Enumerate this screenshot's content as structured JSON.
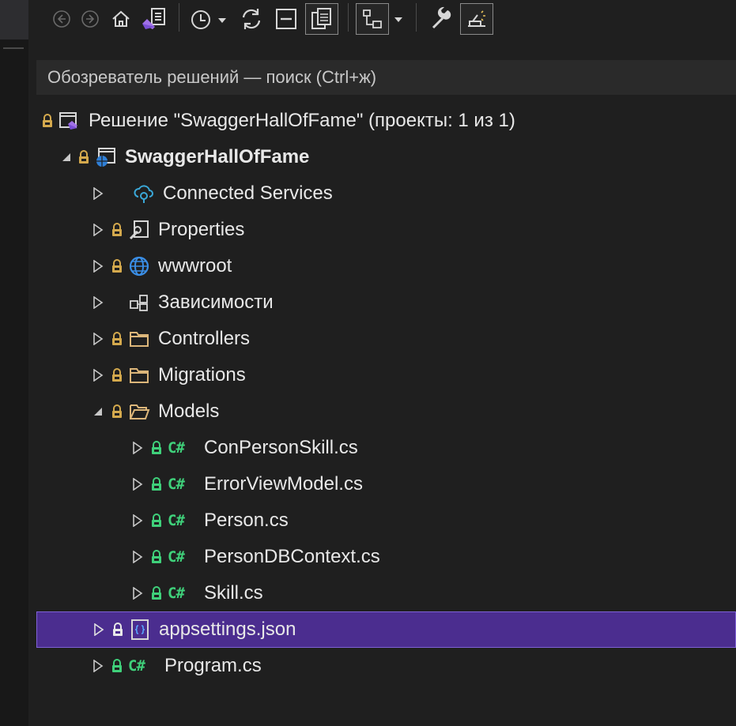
{
  "search": {
    "placeholder": "Обозреватель решений — поиск (Ctrl+ж)"
  },
  "tree": {
    "solution": "Решение \"SwaggerHallOfFame\" (проекты: 1 из 1)",
    "project": "SwaggerHallOfFame",
    "items": [
      {
        "label": "Connected Services",
        "icon": "connected-services-icon"
      },
      {
        "label": "Properties",
        "icon": "properties-icon"
      },
      {
        "label": "wwwroot",
        "icon": "globe-icon"
      },
      {
        "label": "Зависимости",
        "icon": "dependencies-icon"
      },
      {
        "label": "Controllers",
        "icon": "folder-icon"
      },
      {
        "label": "Migrations",
        "icon": "folder-icon"
      },
      {
        "label": "Models",
        "icon": "folder-open-icon"
      },
      {
        "label": "ConPersonSkill.cs",
        "icon": "csharp-icon"
      },
      {
        "label": "ErrorViewModel.cs",
        "icon": "csharp-icon"
      },
      {
        "label": "Person.cs",
        "icon": "csharp-icon"
      },
      {
        "label": "PersonDBContext.cs",
        "icon": "csharp-icon"
      },
      {
        "label": "Skill.cs",
        "icon": "csharp-icon"
      },
      {
        "label": "appsettings.json",
        "icon": "json-file-icon"
      },
      {
        "label": "Program.cs",
        "icon": "csharp-icon"
      }
    ],
    "cs_glyph": "C#"
  },
  "colors": {
    "background": "#1f1f1f",
    "selection": "#4b2d8f",
    "lock": "#d4a94d",
    "csharp": "#3fd07a",
    "folder": "#dcb67a"
  }
}
